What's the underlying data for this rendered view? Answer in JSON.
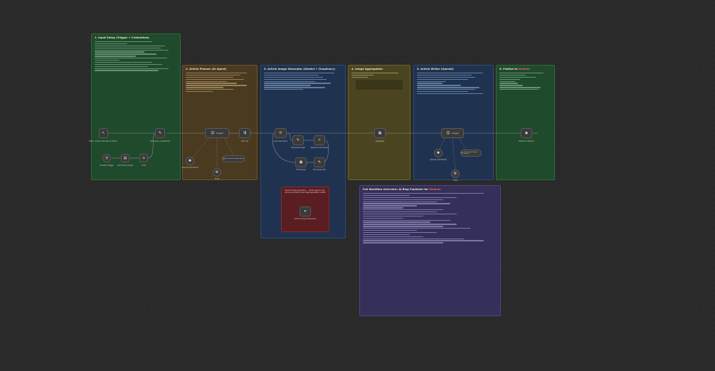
{
  "sections": {
    "input_setup": {
      "title": "1. Input Setup (Trigger + Credentials)"
    },
    "article_planner": {
      "title": "2. Article Planner (AI Agent)"
    },
    "image_generator": {
      "title": "3. Article Image Generator (Gemini + Cloudinary)"
    },
    "image_aggregation": {
      "title": "4. Image Aggregation"
    },
    "article_writer": {
      "title": "5. Article Writer (OpenAI)"
    },
    "publish": {
      "title": "6. Publish to ",
      "title_accent": "Medium"
    },
    "overview": {
      "title": "Full Workflow Overview: AI Blog Publisher for ",
      "title_accent": "Medium"
    },
    "warning": {
      "text": "Gemini image generation ... Some regions may not have access to the image generation model"
    }
  },
  "nodes": {
    "manual_trigger": "When clicking 'Execute workflow'",
    "schedule_trigger": "Schedule Trigger",
    "set_creds": "Set Creds & Inputs",
    "code": "Code",
    "set_fields": "Set Inputs / Credentials",
    "ai_agent": "AI Agent",
    "split_out": "Split Out",
    "openai_chat": "OpenAI Chat Model",
    "structured_parser": "Structured Output Parser",
    "think": "Think",
    "loop_items": "Loop Over Items",
    "gen_image": "Generate Image",
    "upload_image": "Upload to Cloudinary",
    "edit_image": "Edit Image",
    "set_url": "Set Image URL",
    "gemini_image": "Gemini Image Generation",
    "aggregate": "Aggregate",
    "article_agent": "AI Agent",
    "openai_model": "OpenAI Chat Model",
    "output_parser": "Structured Output Parser",
    "think2": "Think",
    "publish_medium": "Publish to Medium"
  },
  "colors": {
    "green": "#1f4a2c",
    "brown": "#4a3a1f",
    "blue": "#1f3350",
    "olive": "#4a4520",
    "purple": "#35305a",
    "red": "#5a1e22",
    "accent_red": "#ff5a5a"
  }
}
